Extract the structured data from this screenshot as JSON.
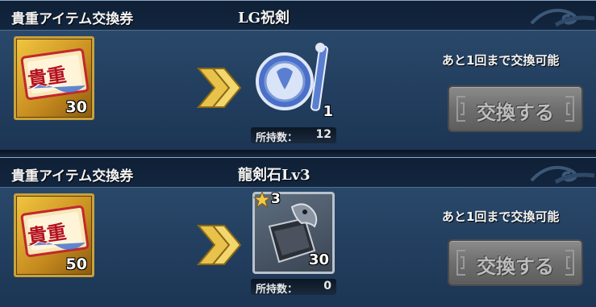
{
  "offers": [
    {
      "ticket_label": "貴重アイテム交換券",
      "ticket_icon": "kichou-ticket-icon",
      "ticket_stamp": "貴重",
      "ticket_qty": "30",
      "reward_name": "LG祝剣",
      "reward_icon": "blessed-sword-emblem-icon",
      "reward_qty": "1",
      "owned_label": "所持数：",
      "owned_value": "12",
      "remaining_text": "あと1回まで交換可能",
      "button_label": "交換する"
    },
    {
      "ticket_label": "貴重アイテム交換券",
      "ticket_icon": "kichou-ticket-icon",
      "ticket_stamp": "貴重",
      "ticket_qty": "50",
      "reward_name": "龍剣石Lv3",
      "reward_icon": "dragon-sword-stone-icon",
      "reward_star": "3",
      "reward_qty": "30",
      "owned_label": "所持数：",
      "owned_value": "0",
      "remaining_text": "あと1回まで交換可能",
      "button_label": "交換する"
    }
  ],
  "colors": {
    "panel_top": "#3a5a7e",
    "panel_bottom": "#1c3554",
    "header_bg": "#0f2036",
    "arrow_gold": "#e8c24a",
    "button_gray": "#6e6e6e"
  }
}
